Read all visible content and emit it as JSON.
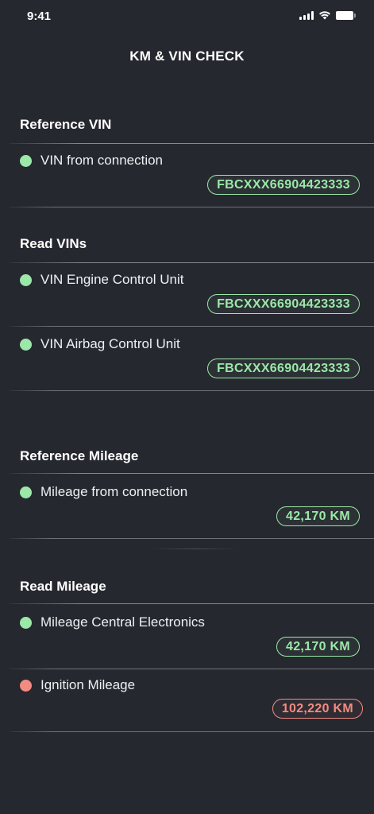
{
  "status_bar": {
    "time": "9:41"
  },
  "header": {
    "title": "KM & VIN CHECK"
  },
  "colors": {
    "ok": "#9be8a8",
    "error": "#f28b81",
    "background": "#26282f"
  },
  "sections": {
    "reference_vin": {
      "title": "Reference VIN",
      "items": [
        {
          "label": "VIN from connection",
          "value": "FBCXXX66904423333",
          "status": "ok"
        }
      ]
    },
    "read_vins": {
      "title": "Read VINs",
      "items": [
        {
          "label": "VIN Engine Control Unit",
          "value": "FBCXXX66904423333",
          "status": "ok"
        },
        {
          "label": "VIN Airbag Control Unit",
          "value": "FBCXXX66904423333",
          "status": "ok"
        }
      ]
    },
    "reference_mileage": {
      "title": "Reference Mileage",
      "items": [
        {
          "label": "Mileage from connection",
          "value": "42,170 KM",
          "status": "ok"
        }
      ]
    },
    "read_mileage": {
      "title": "Read Mileage",
      "items": [
        {
          "label": "Mileage Central Electronics",
          "value": "42,170 KM",
          "status": "ok"
        },
        {
          "label": "Ignition Mileage",
          "value": "102,220 KM",
          "status": "error"
        }
      ]
    }
  }
}
